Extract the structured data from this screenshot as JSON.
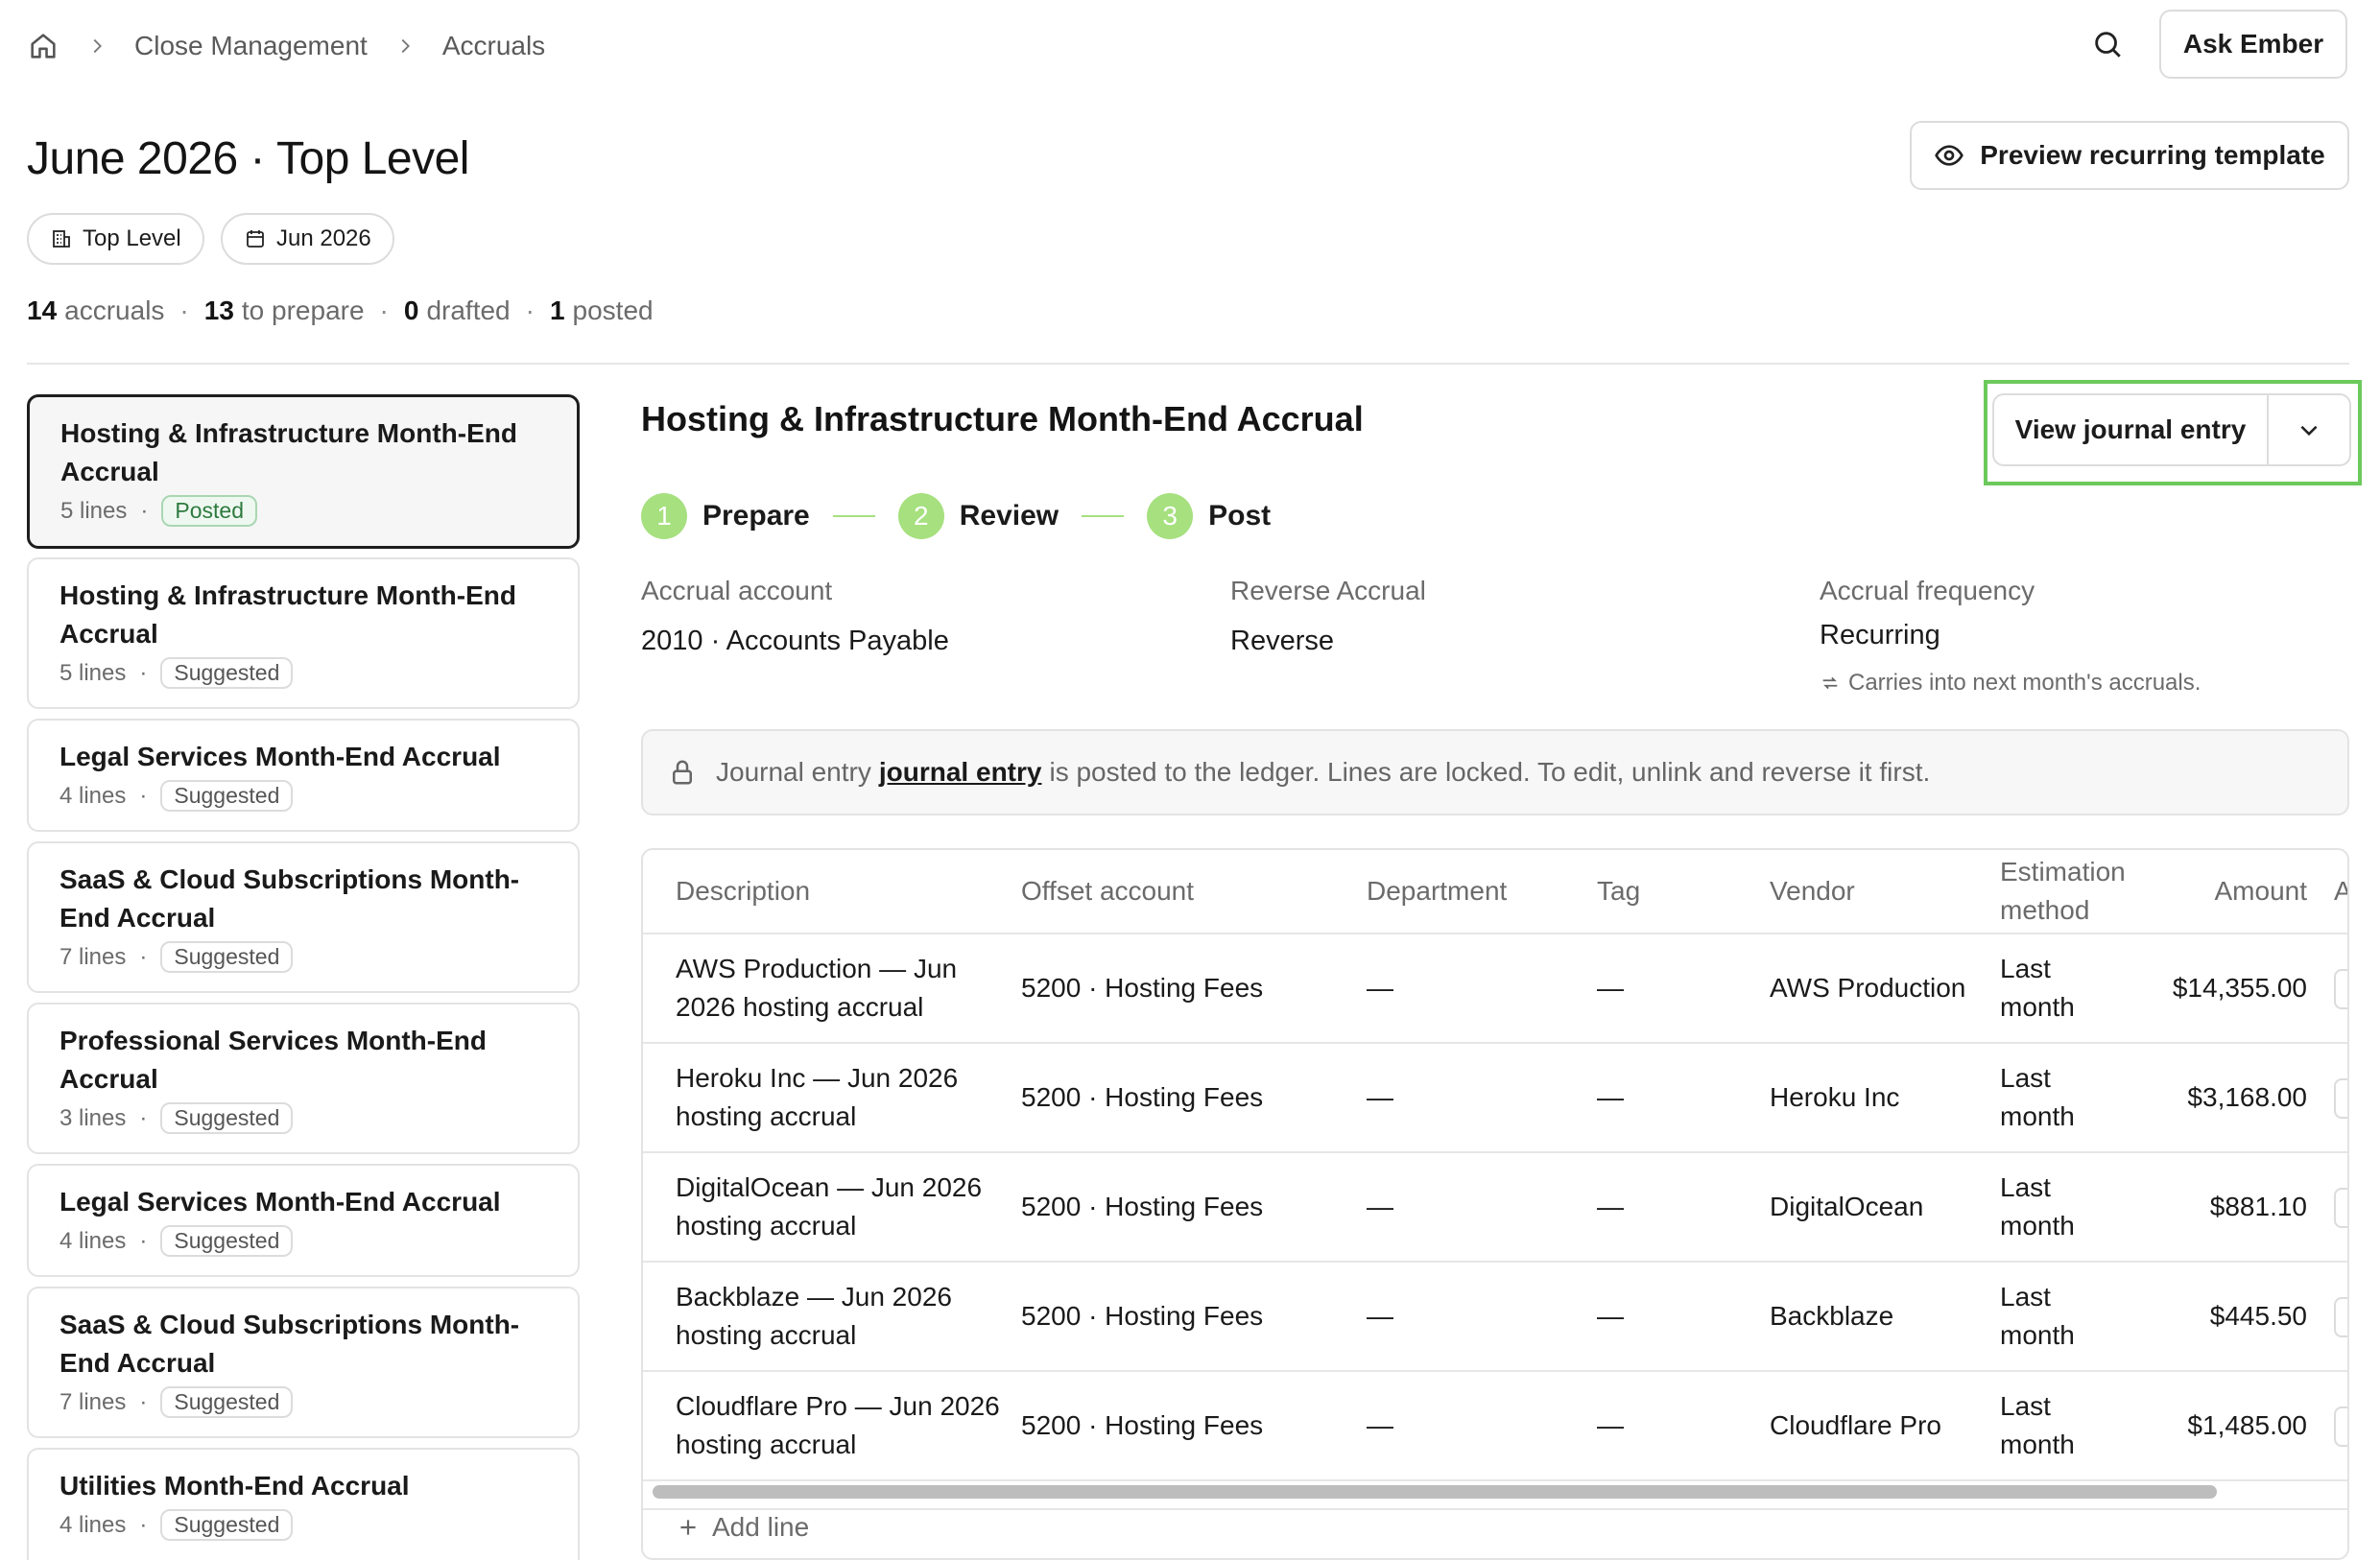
{
  "breadcrumb": {
    "items": [
      "Close Management",
      "Accruals"
    ]
  },
  "header": {
    "ask_label": "Ask Ember",
    "preview_label": "Preview recurring template"
  },
  "page": {
    "title": "June 2026 · Top Level",
    "chips": [
      {
        "icon": "building-icon",
        "label": "Top Level"
      },
      {
        "icon": "calendar-icon",
        "label": "Jun 2026"
      }
    ],
    "stats": [
      {
        "value": "14",
        "label": "accruals"
      },
      {
        "value": "13",
        "label": "to prepare"
      },
      {
        "value": "0",
        "label": "drafted"
      },
      {
        "value": "1",
        "label": "posted"
      }
    ]
  },
  "accruals": [
    {
      "title": "Hosting & Infrastructure Month-End Accrual",
      "lines": "5 lines",
      "status": "Posted",
      "active": true
    },
    {
      "title": "Hosting & Infrastructure Month-End Accrual",
      "lines": "5 lines",
      "status": "Suggested"
    },
    {
      "title": "Legal Services Month-End Accrual",
      "lines": "4 lines",
      "status": "Suggested"
    },
    {
      "title": "SaaS & Cloud Subscriptions Month-End Accrual",
      "lines": "7 lines",
      "status": "Suggested"
    },
    {
      "title": "Professional Services Month-End Accrual",
      "lines": "3 lines",
      "status": "Suggested"
    },
    {
      "title": "Legal Services Month-End Accrual",
      "lines": "4 lines",
      "status": "Suggested"
    },
    {
      "title": "SaaS & Cloud Subscriptions Month-End Accrual",
      "lines": "7 lines",
      "status": "Suggested"
    },
    {
      "title": "Utilities Month-End Accrual",
      "lines": "4 lines",
      "status": "Suggested"
    }
  ],
  "detail": {
    "title": "Hosting & Infrastructure Month-End Accrual",
    "view_je_label": "View journal entry",
    "steps": [
      {
        "num": "1",
        "label": "Prepare"
      },
      {
        "num": "2",
        "label": "Review"
      },
      {
        "num": "3",
        "label": "Post"
      }
    ],
    "fields": {
      "accrual_account": {
        "label": "Accrual account",
        "value": "2010 · Accounts Payable"
      },
      "reverse": {
        "label": "Reverse Accrual",
        "value": "Reverse"
      },
      "frequency": {
        "label": "Accrual frequency",
        "value": "Recurring",
        "note": "Carries into next month's accruals."
      }
    },
    "notice": {
      "prefix": "Journal entry",
      "link": "journal entry",
      "suffix": "is posted to the ledger. Lines are locked. To edit, unlink and reverse it first."
    },
    "table": {
      "columns": [
        "Description",
        "Offset account",
        "Department",
        "Tag",
        "Vendor",
        "Estimation method",
        "Amount",
        "A"
      ],
      "rows": [
        {
          "description": "AWS Production — Jun 2026 hosting accrual",
          "offset": "5200 · Hosting Fees",
          "department": "—",
          "tag": "—",
          "vendor": "AWS Production",
          "method": "Last month",
          "amount": "$14,355.00"
        },
        {
          "description": "Heroku Inc — Jun 2026 hosting accrual",
          "offset": "5200 · Hosting Fees",
          "department": "—",
          "tag": "—",
          "vendor": "Heroku Inc",
          "method": "Last month",
          "amount": "$3,168.00"
        },
        {
          "description": "DigitalOcean — Jun 2026 hosting accrual",
          "offset": "5200 · Hosting Fees",
          "department": "—",
          "tag": "—",
          "vendor": "DigitalOcean",
          "method": "Last month",
          "amount": "$881.10"
        },
        {
          "description": "Backblaze — Jun 2026 hosting accrual",
          "offset": "5200 · Hosting Fees",
          "department": "—",
          "tag": "—",
          "vendor": "Backblaze",
          "method": "Last month",
          "amount": "$445.50"
        },
        {
          "description": "Cloudflare Pro — Jun 2026 hosting accrual",
          "offset": "5200 · Hosting Fees",
          "department": "—",
          "tag": "—",
          "vendor": "Cloudflare Pro",
          "method": "Last month",
          "amount": "$1,485.00"
        }
      ],
      "add_line_label": "Add line"
    }
  },
  "colors": {
    "step_green": "#a6e07f",
    "highlight_green": "#6cc95c",
    "posted_green": "#2d7a3f"
  }
}
